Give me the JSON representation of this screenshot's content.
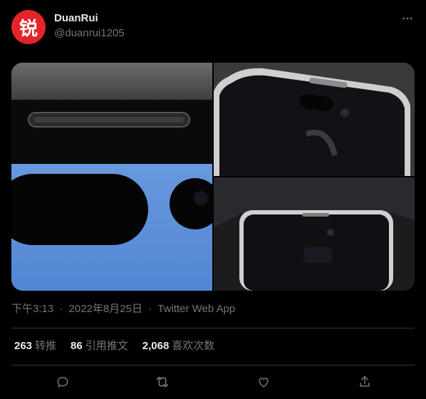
{
  "tweet": {
    "author": {
      "avatar_glyph": "锐",
      "display_name": "DuanRui",
      "handle": "@duanrui1205"
    },
    "meta": {
      "time": "下午3:13",
      "separator": "·",
      "date": "2022年8月25日",
      "source": "Twitter Web App"
    },
    "stats": {
      "retweets": "263",
      "retweets_label": "转推",
      "quotes": "86",
      "quotes_label": "引用推文",
      "likes": "2,068",
      "likes_label": "喜欢次数"
    },
    "icons": {
      "more": "more-icon",
      "reply": "reply-icon",
      "retweet": "retweet-icon",
      "like": "heart-icon",
      "share": "share-icon"
    }
  },
  "colors": {
    "background": "#000000",
    "text": "#e7e9ea",
    "muted": "#71767b",
    "divider": "#2f3336",
    "avatar_bg": "#e3242b"
  }
}
